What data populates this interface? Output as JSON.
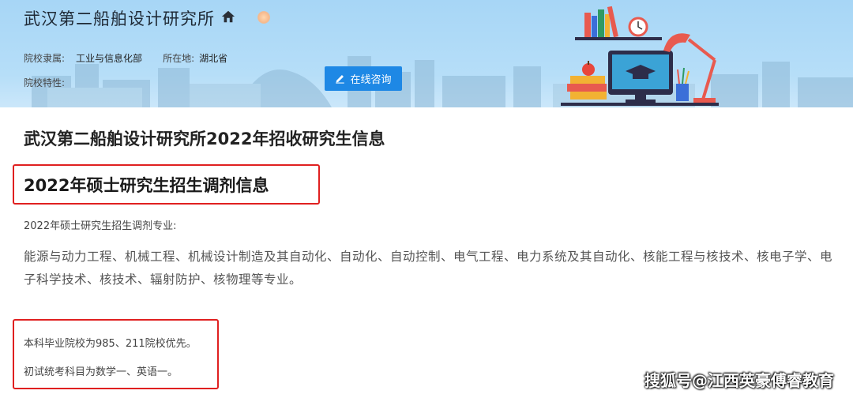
{
  "header": {
    "institution_name": "武汉第二船舶设计研究所",
    "affiliation_label": "院校隶属:",
    "affiliation_value": "工业与信息化部",
    "location_label": "所在地:",
    "location_value": "湖北省",
    "features_label": "院校特性:",
    "consult_button": "在线咨询",
    "icons": [
      "home-icon",
      "pencil-icon"
    ],
    "colors": {
      "banner": "#b6def8",
      "button": "#1e88e5",
      "highlight": "#e02020"
    }
  },
  "article": {
    "title": "武汉第二船舶设计研究所2022年招收研究生信息",
    "section_heading": "2022年硕士研究生招生调剂信息",
    "majors_label": "2022年硕士研究生招生调剂专业:",
    "majors_text": "能源与动力工程、机械工程、机械设计制造及其自动化、自动化、自动控制、电气工程、电力系统及其自动化、核能工程与核技术、核电子学、电子科学技术、核技术、辐射防护、核物理等专业。",
    "note_priority": "本科毕业院校为985、211院校优先。",
    "note_exam": "初试统考科目为数学一、英语一。"
  },
  "watermark": "搜狐号@江西英豪傅睿教育"
}
